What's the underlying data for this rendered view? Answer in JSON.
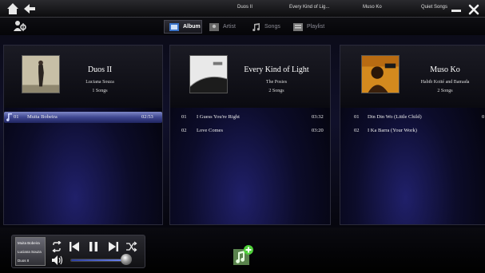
{
  "topbar": {
    "tabs": [
      "Duos II",
      "Every Kind of Lig...",
      "Muso Ko",
      "Quiet Songs"
    ]
  },
  "filters": [
    {
      "label": "Album",
      "active": true
    },
    {
      "label": "Artist",
      "active": false
    },
    {
      "label": "Songs",
      "active": false
    },
    {
      "label": "Playlist",
      "active": false
    }
  ],
  "albums": [
    {
      "title": "Duos II",
      "artist": "Luciana Souza",
      "count": "1 Songs",
      "tracks": [
        {
          "num": "01",
          "name": "Muita Bobeira",
          "duration": "02:53",
          "selected": true
        }
      ]
    },
    {
      "title": "Every Kind of Light",
      "artist": "The Posies",
      "count": "2 Songs",
      "tracks": [
        {
          "num": "01",
          "name": "I Guess You're Right",
          "duration": "03:32",
          "selected": false
        },
        {
          "num": "02",
          "name": "Love Comes",
          "duration": "03:20",
          "selected": false
        }
      ]
    },
    {
      "title": "Muso Ko",
      "artist": "Habib Koité and Bamada",
      "count": "2 Songs",
      "tracks": [
        {
          "num": "01",
          "name": "Din Din Wo (Little Child)",
          "duration": "0",
          "selected": false
        },
        {
          "num": "02",
          "name": "I Ka Barra (Your Work)",
          "duration": "0",
          "selected": false
        }
      ]
    }
  ],
  "now_playing": {
    "title": "Muita Bobeira",
    "artist": "Luciana Souza",
    "album": "Duos II",
    "volume": 0.92
  },
  "icons": {
    "home": "home-icon",
    "back": "back-arrow-icon",
    "minimize": "minimize-icon",
    "close": "close-icon",
    "settings": "user-settings-icon",
    "add_music": "add-music-icon"
  },
  "colors": {
    "accent": "#4a5acc",
    "add_green": "#4fcf3a"
  }
}
